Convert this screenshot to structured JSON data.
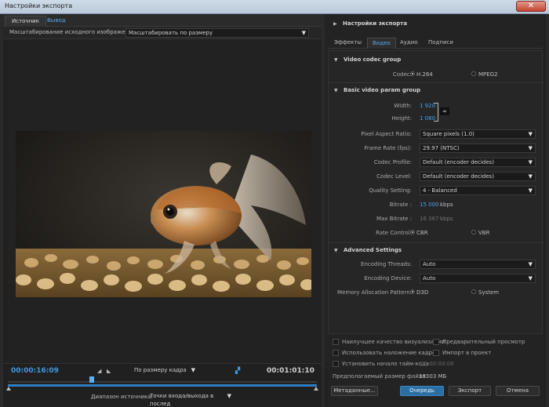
{
  "window": {
    "title": "Настройки экспорта",
    "close_label": "✕"
  },
  "left": {
    "tabs": [
      {
        "label": "Источник"
      },
      {
        "label": "Вывод"
      }
    ],
    "scale_label": "Масштабирование исходного изображения:",
    "scale_value": "Масштабировать по размеру",
    "timecode_start": "00:00:16:09",
    "timecode_end": "00:01:01:10",
    "fit_select": "По размеру кадра",
    "source_range_label": "Диапазон источника:",
    "source_range_value": "Точки входа/выхода в послед"
  },
  "right": {
    "export_settings": "Настройки экспорта",
    "tabs": [
      {
        "label": "Эффекты"
      },
      {
        "label": "Видео"
      },
      {
        "label": "Аудио"
      },
      {
        "label": "Подписи"
      }
    ],
    "video_codec_group": "Video codec group",
    "codec_label": "Codec:",
    "codec_opt1": "H.264",
    "codec_opt2": "MPEG2",
    "basic_group": "Basic video param group",
    "width_label": "Width:",
    "width_value": "1 920",
    "height_label": "Height:",
    "height_value": "1 080",
    "par_label": "Pixel Aspect Ratio:",
    "par_value": "Square pixels (1.0)",
    "fps_label": "Frame Rate (fps):",
    "fps_value": "29.97 (NTSC)",
    "profile_label": "Codec Profile:",
    "profile_value": "Default (encoder decides)",
    "level_label": "Codec Level:",
    "level_value": "Default (encoder decides)",
    "quality_label": "Quality Setting:",
    "quality_value": "4 - Balanced",
    "bitrate_label": "Bitrate :",
    "bitrate_value": "15 000",
    "bitrate_unit": "kbps",
    "maxbitrate_label": "Max Bitrate :",
    "maxbitrate_value": "16 367",
    "maxbitrate_unit": "kbps",
    "ratecontrol_label": "Rate Control:",
    "rc_opt1": "CBR",
    "rc_opt2": "VBR",
    "advanced_group": "Advanced Settings",
    "threads_label": "Encoding Threads:",
    "threads_value": "Auto",
    "device_label": "Encoding Device:",
    "device_value": "Auto",
    "mem_label": "Memory Allocation Pattern:",
    "mem_opt1": "D3D",
    "mem_opt2": "System",
    "opt_best_quality": "Наилучшее качество визуализации",
    "opt_preview": "Предварительный просмотр",
    "opt_blend": "Использовать наложение кадров",
    "opt_import": "Импорт в проект",
    "opt_timecode": "Установить начало тайм-кода",
    "opt_timecode_value": "00:00:00:00",
    "filesize_label": "Предполагаемый размер файла:",
    "filesize_value": "18303 МБ",
    "btn_metadata": "Метаданные...",
    "btn_queue": "Очередь",
    "btn_export": "Экспорт",
    "btn_cancel": "Отмена"
  }
}
